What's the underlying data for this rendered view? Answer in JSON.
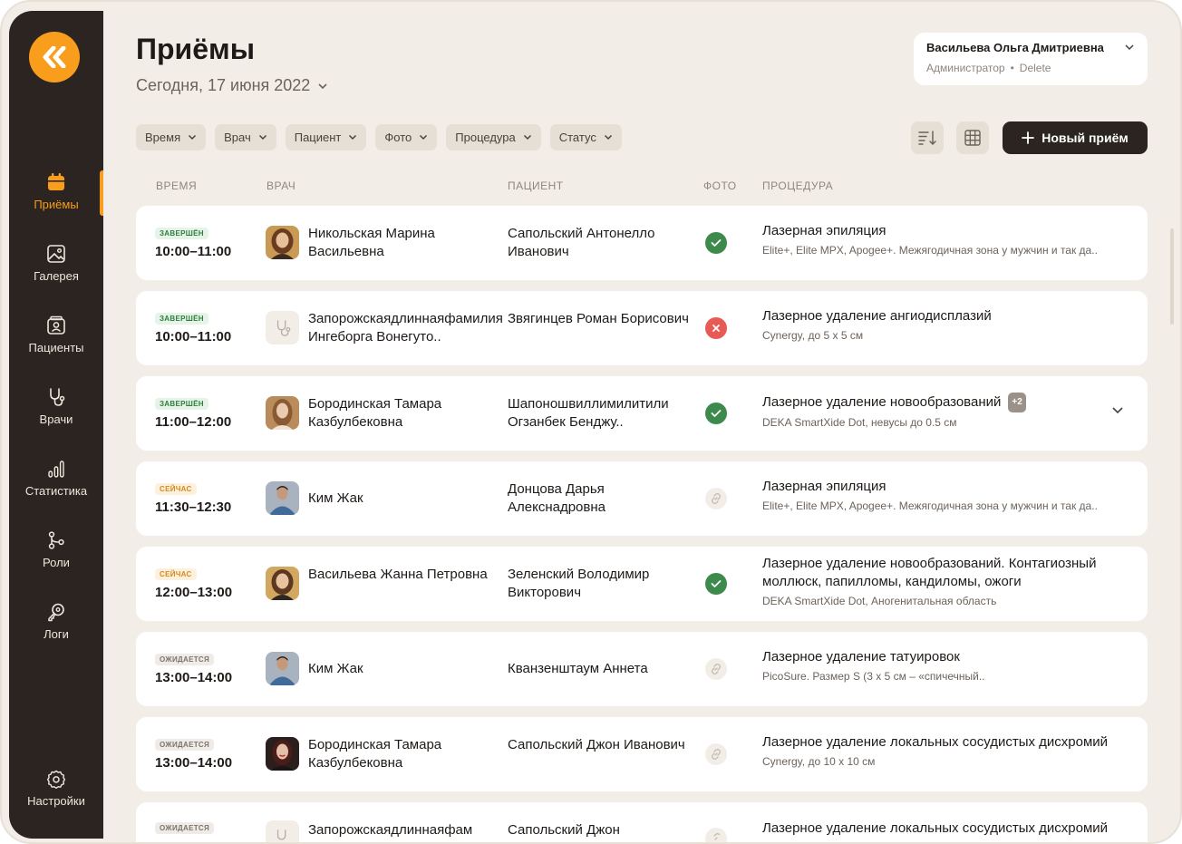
{
  "sidebar": {
    "items": [
      {
        "label": "Приёмы",
        "icon": "calendar-icon",
        "active": true
      },
      {
        "label": "Галерея",
        "icon": "image-icon"
      },
      {
        "label": "Пациенты",
        "icon": "patient-card-icon"
      },
      {
        "label": "Врачи",
        "icon": "stethoscope-icon"
      },
      {
        "label": "Статистика",
        "icon": "bar-chart-icon"
      },
      {
        "label": "Роли",
        "icon": "branch-icon"
      },
      {
        "label": "Логи",
        "icon": "key-icon"
      }
    ],
    "settings_label": "Настройки"
  },
  "header": {
    "title": "Приёмы",
    "date": "Сегодня, 17 июня 2022"
  },
  "user": {
    "name": "Васильева Ольга Дмитриевна",
    "role": "Администратор",
    "action": "Delete"
  },
  "filters": [
    "Время",
    "Врач",
    "Пациент",
    "Фото",
    "Процедура",
    "Статус"
  ],
  "toolbar": {
    "new_label": "Новый приём"
  },
  "columns": {
    "time": "ВРЕМЯ",
    "doctor": "ВРАЧ",
    "patient": "ПАЦИЕНТ",
    "photo": "ФОТО",
    "procedure": "ПРОЦЕДУРА"
  },
  "appointments": [
    {
      "status": "завершён",
      "status_kind": "done",
      "time": "10:00–11:00",
      "doctor": "Никольская Марина Васильевна",
      "patient": "Сапольский Антонелло Иванович",
      "photo": "ok",
      "procedure": "Лазерная эпиляция",
      "details": "Elite+, Elite MPX, Apogee+. Межягодичная зона у мужчин и так да.."
    },
    {
      "status": "завершён",
      "status_kind": "done",
      "time": "10:00–11:00",
      "doctor": "Запорожскаядлиннаяфамилия Ингеборга Вонегуто..",
      "patient": "Звягинцев Роман Борисович",
      "photo": "fail",
      "procedure": "Лазерное удаление ангиодисплазий",
      "details": "Cynergy, до 5 х 5 см"
    },
    {
      "status": "завершён",
      "status_kind": "done",
      "time": "11:00–12:00",
      "doctor": "Бородинская Тамара Казбулбековна",
      "patient": "Шапоношвиллимилитили Огзанбек Бенджу..",
      "photo": "ok",
      "procedure": "Лазерное удаление новообразований",
      "extra": "+2",
      "details": "DEKA SmartXide Dot, невусы до 0.5 см"
    },
    {
      "status": "сейчас",
      "status_kind": "now",
      "time": "11:30–12:30",
      "doctor": "Ким Жак",
      "patient": "Донцова Дарья Алекснадровна",
      "photo": "pending",
      "procedure": "Лазерная эпиляция",
      "details": "Elite+, Elite MPX, Apogee+. Межягодичная зона у мужчин и так да.."
    },
    {
      "status": "сейчас",
      "status_kind": "now",
      "time": "12:00–13:00",
      "doctor": "Васильева Жанна Петровна",
      "patient": "Зеленский Володимир Викторович",
      "photo": "ok",
      "procedure": "Лазерное удаление новообразований. Контагиозный моллюск, папилломы, кандиломы, ожоги",
      "details": "DEKA SmartXide Dot, Аногенитальная область"
    },
    {
      "status": "ожидается",
      "status_kind": "wait",
      "time": "13:00–14:00",
      "doctor": "Ким Жак",
      "patient": "Кванзенштаум Аннета",
      "photo": "pending",
      "procedure": "Лазерное удаление татуировок",
      "details": "PicoSure. Размер S (3 х 5 см – «спичечный.."
    },
    {
      "status": "ожидается",
      "status_kind": "wait",
      "time": "13:00–14:00",
      "doctor": "Бородинская Тамара Казбулбековна",
      "patient": "Сапольский Джон Иванович",
      "photo": "pending",
      "procedure": "Лазерное удаление локальных сосудистых дисхромий",
      "details": "Cynergy, до 10 х 10 см"
    },
    {
      "status": "ожидается",
      "status_kind": "wait",
      "time": "",
      "doctor": "Запорожскаядлиннаяфам",
      "patient": "Сапольский Джон",
      "photo": "pending",
      "procedure": "Лазерное удаление локальных сосудистых дисхромий",
      "details": ""
    }
  ]
}
